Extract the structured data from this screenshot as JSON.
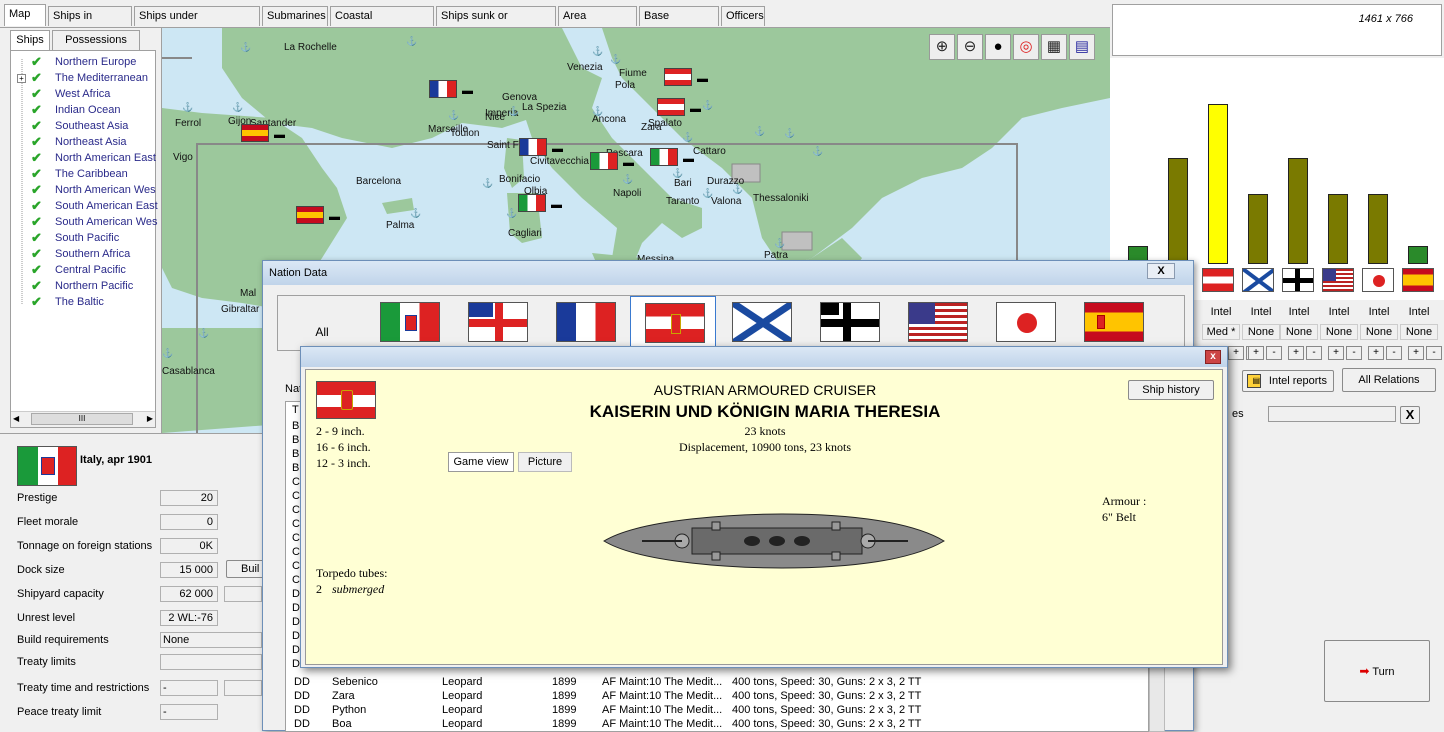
{
  "tabs": [
    "Map",
    "Ships in service",
    "Ships under construction",
    "Submarines",
    "Coastal fortifications",
    "Ships sunk or scrapped",
    "Area overview",
    "Base overview",
    "Officers"
  ],
  "resolution": "1461 x 766",
  "side_tabs": [
    "Ships",
    "Possessions"
  ],
  "regions": [
    "Northern Europe",
    "The Mediterranean",
    "West Africa",
    "Indian Ocean",
    "Southeast Asia",
    "Northeast Asia",
    "North American East",
    "The Caribbean",
    "North American Wes",
    "South American East",
    "South American Wes",
    "South Pacific",
    "Southern Africa",
    "Central Pacific",
    "Northern Pacific",
    "The Baltic"
  ],
  "scroll_glyph": "III",
  "nation_panel": {
    "title": "Italy, apr 1901",
    "rows": [
      {
        "label": "Prestige",
        "value": "20"
      },
      {
        "label": "Fleet morale",
        "value": "0"
      },
      {
        "label": "Tonnage on foreign stations",
        "value": "0K"
      },
      {
        "label": "Dock size",
        "value": "15 000"
      },
      {
        "label": "Shipyard capacity",
        "value": "62 000"
      },
      {
        "label": "Unrest level",
        "value": "2 WL:-76"
      },
      {
        "label": "Build requirements",
        "value": "None"
      },
      {
        "label": "Treaty limits",
        "value": ""
      },
      {
        "label": "Treaty time and restrictions",
        "value": "-"
      },
      {
        "label": "Peace treaty limit",
        "value": "-"
      }
    ],
    "build_button": "Buil"
  },
  "map_labels": [
    {
      "t": "La Rochelle"
    },
    {
      "t": "Venezia"
    },
    {
      "t": "Fiume"
    },
    {
      "t": "Pola"
    },
    {
      "t": "Genova"
    },
    {
      "t": "La Spezia"
    },
    {
      "t": "Imperia"
    },
    {
      "t": "Nice"
    },
    {
      "t": "Zara"
    },
    {
      "t": "Ferrol"
    },
    {
      "t": "Gijon"
    },
    {
      "t": "Santander"
    },
    {
      "t": "Marseille"
    },
    {
      "t": "Toulon"
    },
    {
      "t": "Ancona"
    },
    {
      "t": "Spalato"
    },
    {
      "t": "Vigo"
    },
    {
      "t": "Saint Florent"
    },
    {
      "t": "Civitavecchia"
    },
    {
      "t": "Pescara"
    },
    {
      "t": "Cattaro"
    },
    {
      "t": "Barcelona"
    },
    {
      "t": "Bonifacio"
    },
    {
      "t": "Olbia"
    },
    {
      "t": "Bari"
    },
    {
      "t": "Durazzo"
    },
    {
      "t": "Napoli"
    },
    {
      "t": "Taranto"
    },
    {
      "t": "Valona"
    },
    {
      "t": "Thessaloniki"
    },
    {
      "t": "Palma"
    },
    {
      "t": "Cagliari"
    },
    {
      "t": "Patra"
    },
    {
      "t": "Gibraltar"
    },
    {
      "t": "Casablanca"
    },
    {
      "t": "Messina"
    },
    {
      "t": "Mal"
    }
  ],
  "map_tools": [
    "zoom-in",
    "zoom-out",
    "oil-drop",
    "target",
    "base",
    "legend"
  ],
  "right_panel": {
    "intel_labels": [
      "Intel",
      "Intel",
      "Intel",
      "Intel",
      "Intel",
      "Intel",
      "Intel"
    ],
    "intel_values": [
      "Med *",
      "None",
      "None",
      "None",
      "None",
      "None",
      "None"
    ],
    "plus_minus": [
      "+",
      "-"
    ],
    "intel_reports": "Intel reports",
    "all_relations": "All Relations",
    "close": "X",
    "partial_label": "es",
    "turn": "Turn",
    "bars": [
      {
        "level": 0.11,
        "color": "#2a8a2a"
      },
      {
        "level": 0.66,
        "color": "#7a7a00"
      },
      {
        "level": 1.0,
        "color": "#ffff00"
      },
      {
        "level": 0.44,
        "color": "#7a7a00"
      },
      {
        "level": 0.66,
        "color": "#7a7a00"
      },
      {
        "level": 0.44,
        "color": "#7a7a00"
      },
      {
        "level": 0.44,
        "color": "#7a7a00"
      },
      {
        "level": 0.11,
        "color": "#2a8a2a"
      }
    ]
  },
  "nation_data": {
    "title": "Nation Data",
    "all": "All",
    "close": "X",
    "list_header_partial": "Nat",
    "col_partial": "T",
    "partial_types": [
      "B",
      "B",
      "B",
      "B",
      "CA",
      "CA",
      "CA",
      "CA",
      "CA",
      "CL",
      "CL",
      "CL",
      "DD",
      "DD",
      "DD",
      "DD",
      "DD",
      "DD"
    ],
    "rows": [
      {
        "type": "DD",
        "name": "Sebenico",
        "class": "Leopard",
        "year": "1899",
        "loc": "AF Maint:10 The Medit...",
        "desc": "400 tons, Speed: 30, Guns: 2 x 3, 2 TT"
      },
      {
        "type": "DD",
        "name": "Zara",
        "class": "Leopard",
        "year": "1899",
        "loc": "AF Maint:10 The Medit...",
        "desc": "400 tons, Speed: 30, Guns: 2 x 3, 2 TT"
      },
      {
        "type": "DD",
        "name": "Python",
        "class": "Leopard",
        "year": "1899",
        "loc": "AF Maint:10 The Medit...",
        "desc": "400 tons, Speed: 30, Guns: 2 x 3, 2 TT"
      },
      {
        "type": "DD",
        "name": "Boa",
        "class": "Leopard",
        "year": "1899",
        "loc": "AF Maint:10 The Medit...",
        "desc": "400 tons, Speed: 30, Guns: 2 x 3, 2 TT"
      }
    ]
  },
  "ship_popup": {
    "close": "x",
    "type": "AUSTRIAN ARMOURED CRUISER",
    "name": "KAISERIN UND KÖNIGIN MARIA THERESIA",
    "speed": "23 knots",
    "displacement": "Displacement, 10900 tons, 23 knots",
    "guns": [
      "2 - 9 inch.",
      "16 - 6 inch.",
      "12 - 3 inch."
    ],
    "game_view": "Game view",
    "picture": "Picture",
    "ship_history": "Ship history",
    "armour_label": "Armour :",
    "armour_value": "6\" Belt",
    "torpedo_label": "Torpedo tubes:",
    "torpedo_count": "2",
    "torpedo_type": "submerged"
  },
  "colors": {
    "sea": "#cde7f4",
    "land": "#9cc89c",
    "popup_bg": "#ffffd4",
    "accent": "#316ac5"
  }
}
